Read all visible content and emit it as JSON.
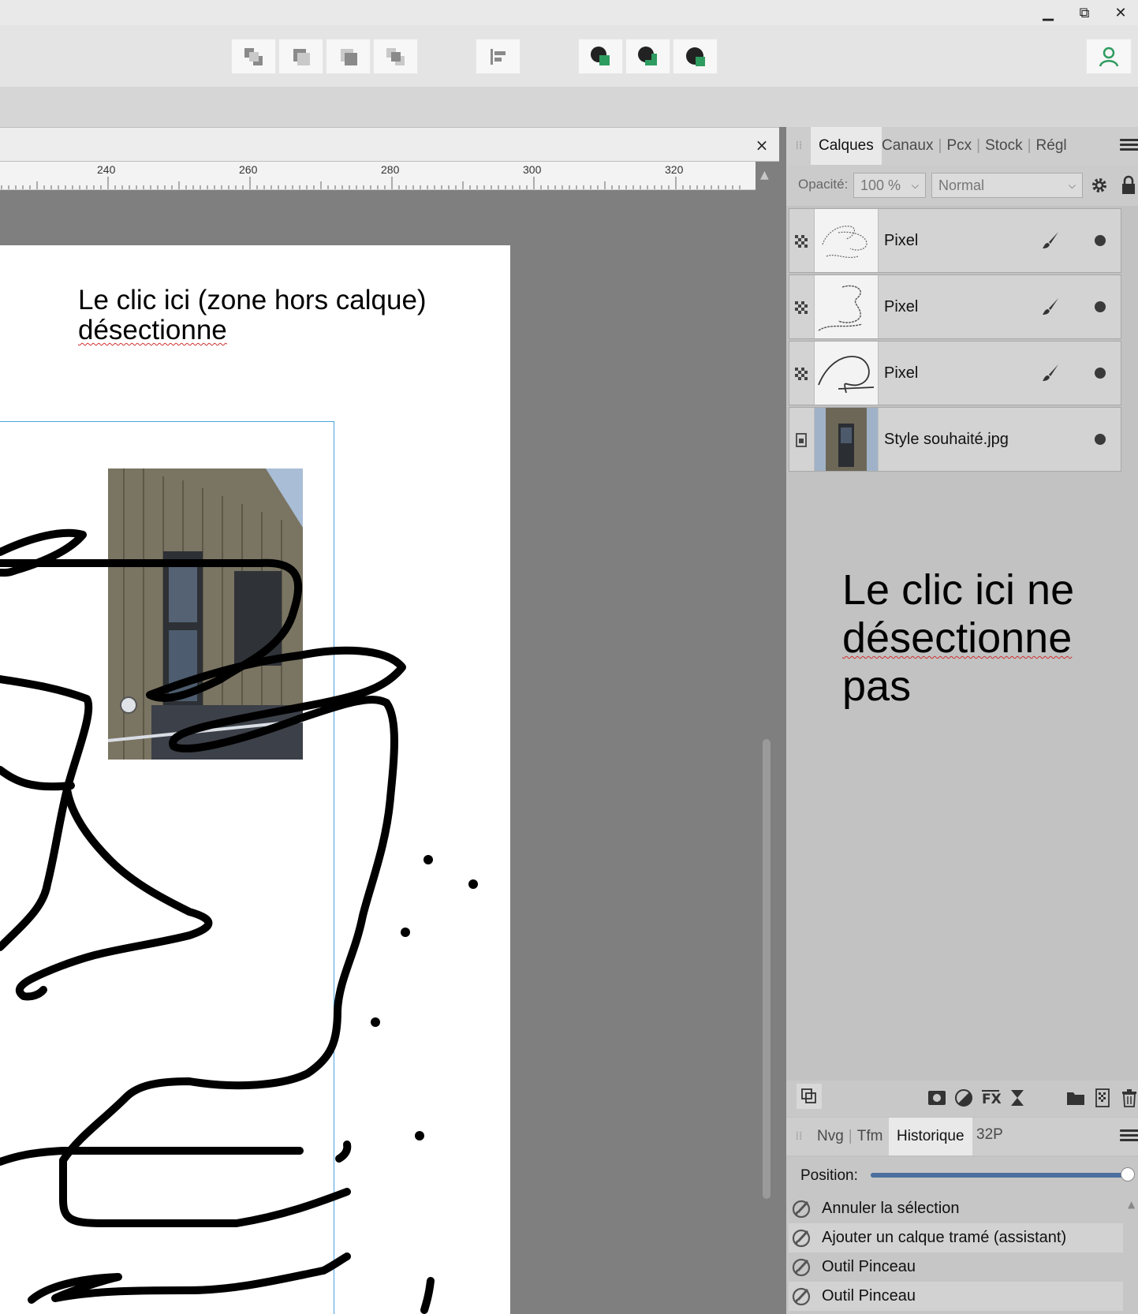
{
  "window": {
    "controls": {
      "minimize": "▁",
      "restore": "⧉",
      "close": "✕"
    }
  },
  "toolbar": {
    "arrange_buttons": [
      "arrange-back-icon",
      "arrange-backward-icon",
      "arrange-forward-icon",
      "arrange-front-icon"
    ],
    "align_button": "align-left-icon",
    "boolean_buttons": [
      "add-shape-icon",
      "intersect-shape-icon",
      "subtract-shape-icon"
    ],
    "account_icon": "user-icon",
    "accent_color": "#2e9b5f"
  },
  "document": {
    "close": "×"
  },
  "ruler": {
    "labels": [
      "240",
      "260",
      "280",
      "300",
      "320"
    ]
  },
  "canvas": {
    "note_line1": "Le clic ici (zone hors calque)",
    "note_line2": "désectionne"
  },
  "layers_panel": {
    "grip": "⁞⁞",
    "tabs": [
      "Calques",
      "Canaux",
      "Pcx",
      "Stock",
      "Régl"
    ],
    "separator": "|",
    "active_tab": "Calques",
    "opacity_label": "Opacité:",
    "opacity_value": "100 %",
    "blend_mode": "Normal",
    "layers": [
      {
        "name": "Pixel",
        "type": "pixel"
      },
      {
        "name": "Pixel",
        "type": "pixel"
      },
      {
        "name": "Pixel",
        "type": "pixel"
      },
      {
        "name": "Style souhaité.jpg",
        "type": "image"
      }
    ],
    "note_line1": "Le clic ici ne",
    "note_line2": "désectionne",
    "note_line3": "pas"
  },
  "history_panel": {
    "tabs": [
      "Nvg",
      "Tfm",
      "Historique",
      "32P"
    ],
    "separator": "|",
    "active_tab": "Historique",
    "position_label": "Position:",
    "position_value": 1.0,
    "items": [
      "Annuler la sélection",
      "Ajouter un calque tramé (assistant)",
      "Outil Pinceau",
      "Outil Pinceau"
    ]
  }
}
